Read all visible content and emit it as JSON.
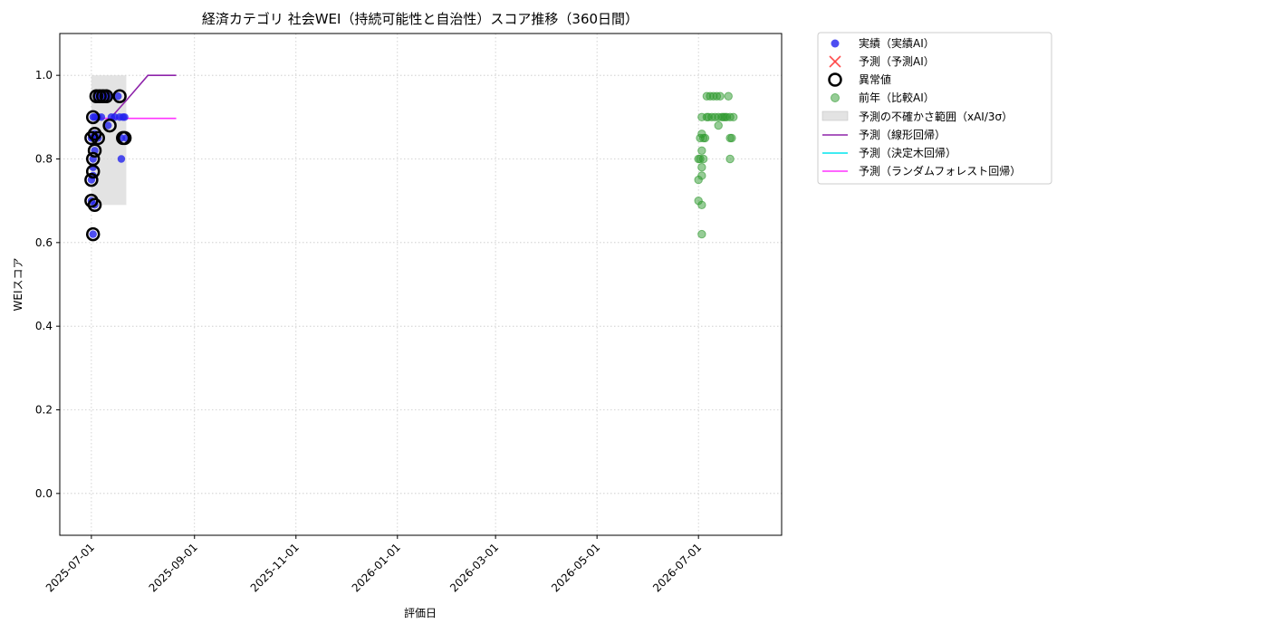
{
  "chart_data": {
    "type": "scatter",
    "title": "経済カテゴリ 社会WEI（持続可能性と自治性）スコア推移（360日間）",
    "xlabel": "評価日",
    "ylabel": "WEIスコア",
    "xlim": [
      "2025-06-12",
      "2026-08-20"
    ],
    "ylim": [
      -0.1,
      1.1
    ],
    "xticks": [
      "2025-07-01",
      "2025-09-01",
      "2025-11-01",
      "2026-01-01",
      "2026-03-01",
      "2026-05-01",
      "2026-07-01"
    ],
    "yticks": [
      "0.0",
      "0.2",
      "0.4",
      "0.6",
      "0.8",
      "1.0"
    ],
    "grid": true,
    "legend_position": "outside-right-top",
    "colors": {
      "actual": "#2222ee",
      "forecast": "#ff3b3b",
      "anomaly": "#000000",
      "previous_year": "#2e9a2e",
      "uncertainty": "#d9d9d9",
      "linear": "#8e24aa",
      "decision_tree": "#00e5ee",
      "random_forest": "#ff33ff"
    },
    "legend": [
      "実績（実績AI）",
      "予測（予測AI）",
      "異常値",
      "前年（比較AI）",
      "予測の不確かさ範囲（xAI/3σ）",
      "予測（線形回帰）",
      "予測（決定木回帰）",
      "予測（ランダムフォレスト回帰）"
    ],
    "series": [
      {
        "name": "実績（実績AI）",
        "kind": "scatter",
        "points": [
          [
            "2025-07-01",
            0.85
          ],
          [
            "2025-07-01",
            0.75
          ],
          [
            "2025-07-01",
            0.7
          ],
          [
            "2025-07-02",
            0.9
          ],
          [
            "2025-07-02",
            0.85
          ],
          [
            "2025-07-02",
            0.8
          ],
          [
            "2025-07-02",
            0.78
          ],
          [
            "2025-07-02",
            0.76
          ],
          [
            "2025-07-02",
            0.62
          ],
          [
            "2025-07-03",
            0.69
          ],
          [
            "2025-07-03",
            0.82
          ],
          [
            "2025-07-03",
            0.86
          ],
          [
            "2025-07-03",
            0.9
          ],
          [
            "2025-07-04",
            0.95
          ],
          [
            "2025-07-05",
            0.9
          ],
          [
            "2025-07-05",
            0.85
          ],
          [
            "2025-07-06",
            0.95
          ],
          [
            "2025-07-07",
            0.9
          ],
          [
            "2025-07-08",
            0.95
          ],
          [
            "2025-07-10",
            0.95
          ],
          [
            "2025-07-11",
            0.88
          ],
          [
            "2025-07-12",
            0.95
          ],
          [
            "2025-07-13",
            0.9
          ],
          [
            "2025-07-15",
            0.9
          ],
          [
            "2025-07-17",
            0.95
          ],
          [
            "2025-07-18",
            0.9
          ],
          [
            "2025-07-19",
            0.8
          ],
          [
            "2025-07-19",
            0.85
          ],
          [
            "2025-07-20",
            0.9
          ],
          [
            "2025-07-21",
            0.9
          ],
          [
            "2025-07-22",
            0.85
          ]
        ]
      },
      {
        "name": "異常値",
        "kind": "scatter",
        "points": [
          [
            "2025-07-01",
            0.85
          ],
          [
            "2025-07-01",
            0.75
          ],
          [
            "2025-07-01",
            0.7
          ],
          [
            "2025-07-02",
            0.9
          ],
          [
            "2025-07-02",
            0.8
          ],
          [
            "2025-07-02",
            0.77
          ],
          [
            "2025-07-02",
            0.62
          ],
          [
            "2025-07-03",
            0.69
          ],
          [
            "2025-07-03",
            0.82
          ],
          [
            "2025-07-03",
            0.86
          ],
          [
            "2025-07-04",
            0.95
          ],
          [
            "2025-07-05",
            0.85
          ],
          [
            "2025-07-06",
            0.95
          ],
          [
            "2025-07-08",
            0.95
          ],
          [
            "2025-07-10",
            0.95
          ],
          [
            "2025-07-12",
            0.88
          ],
          [
            "2025-07-18",
            0.95
          ],
          [
            "2025-07-20",
            0.85
          ],
          [
            "2025-07-21",
            0.85
          ]
        ]
      },
      {
        "name": "前年（比較AI）",
        "kind": "scatter",
        "points": [
          [
            "2026-07-01",
            0.8
          ],
          [
            "2026-07-01",
            0.75
          ],
          [
            "2026-07-01",
            0.7
          ],
          [
            "2026-07-02",
            0.85
          ],
          [
            "2026-07-02",
            0.8
          ],
          [
            "2026-07-03",
            0.9
          ],
          [
            "2026-07-03",
            0.86
          ],
          [
            "2026-07-03",
            0.82
          ],
          [
            "2026-07-03",
            0.78
          ],
          [
            "2026-07-03",
            0.76
          ],
          [
            "2026-07-03",
            0.62
          ],
          [
            "2026-07-03",
            0.69
          ],
          [
            "2026-07-04",
            0.85
          ],
          [
            "2026-07-04",
            0.8
          ],
          [
            "2026-07-05",
            0.85
          ],
          [
            "2026-07-06",
            0.9
          ],
          [
            "2026-07-06",
            0.95
          ],
          [
            "2026-07-07",
            0.9
          ],
          [
            "2026-07-08",
            0.95
          ],
          [
            "2026-07-09",
            0.9
          ],
          [
            "2026-07-10",
            0.95
          ],
          [
            "2026-07-11",
            0.9
          ],
          [
            "2026-07-12",
            0.95
          ],
          [
            "2026-07-13",
            0.88
          ],
          [
            "2026-07-13",
            0.9
          ],
          [
            "2026-07-14",
            0.95
          ],
          [
            "2026-07-15",
            0.9
          ],
          [
            "2026-07-16",
            0.9
          ],
          [
            "2026-07-17",
            0.9
          ],
          [
            "2026-07-18",
            0.9
          ],
          [
            "2026-07-19",
            0.95
          ],
          [
            "2026-07-20",
            0.9
          ],
          [
            "2026-07-20",
            0.8
          ],
          [
            "2026-07-20",
            0.85
          ],
          [
            "2026-07-21",
            0.85
          ],
          [
            "2026-07-22",
            0.9
          ]
        ]
      },
      {
        "name": "予測（線形回帰）",
        "kind": "line",
        "points": [
          [
            "2025-07-13",
            0.9
          ],
          [
            "2025-07-22",
            0.94
          ],
          [
            "2025-08-04",
            1.0
          ],
          [
            "2025-08-21",
            1.0
          ]
        ]
      },
      {
        "name": "予測（ランダムフォレスト回帰）",
        "kind": "line",
        "points": [
          [
            "2025-07-01",
            0.897
          ],
          [
            "2025-08-21",
            0.897
          ]
        ]
      },
      {
        "name": "予測の不確かさ範囲（xAI/3σ）",
        "kind": "band",
        "x_range": [
          "2025-07-01",
          "2025-07-22"
        ],
        "y_range": [
          0.69,
          1.0
        ]
      }
    ]
  }
}
